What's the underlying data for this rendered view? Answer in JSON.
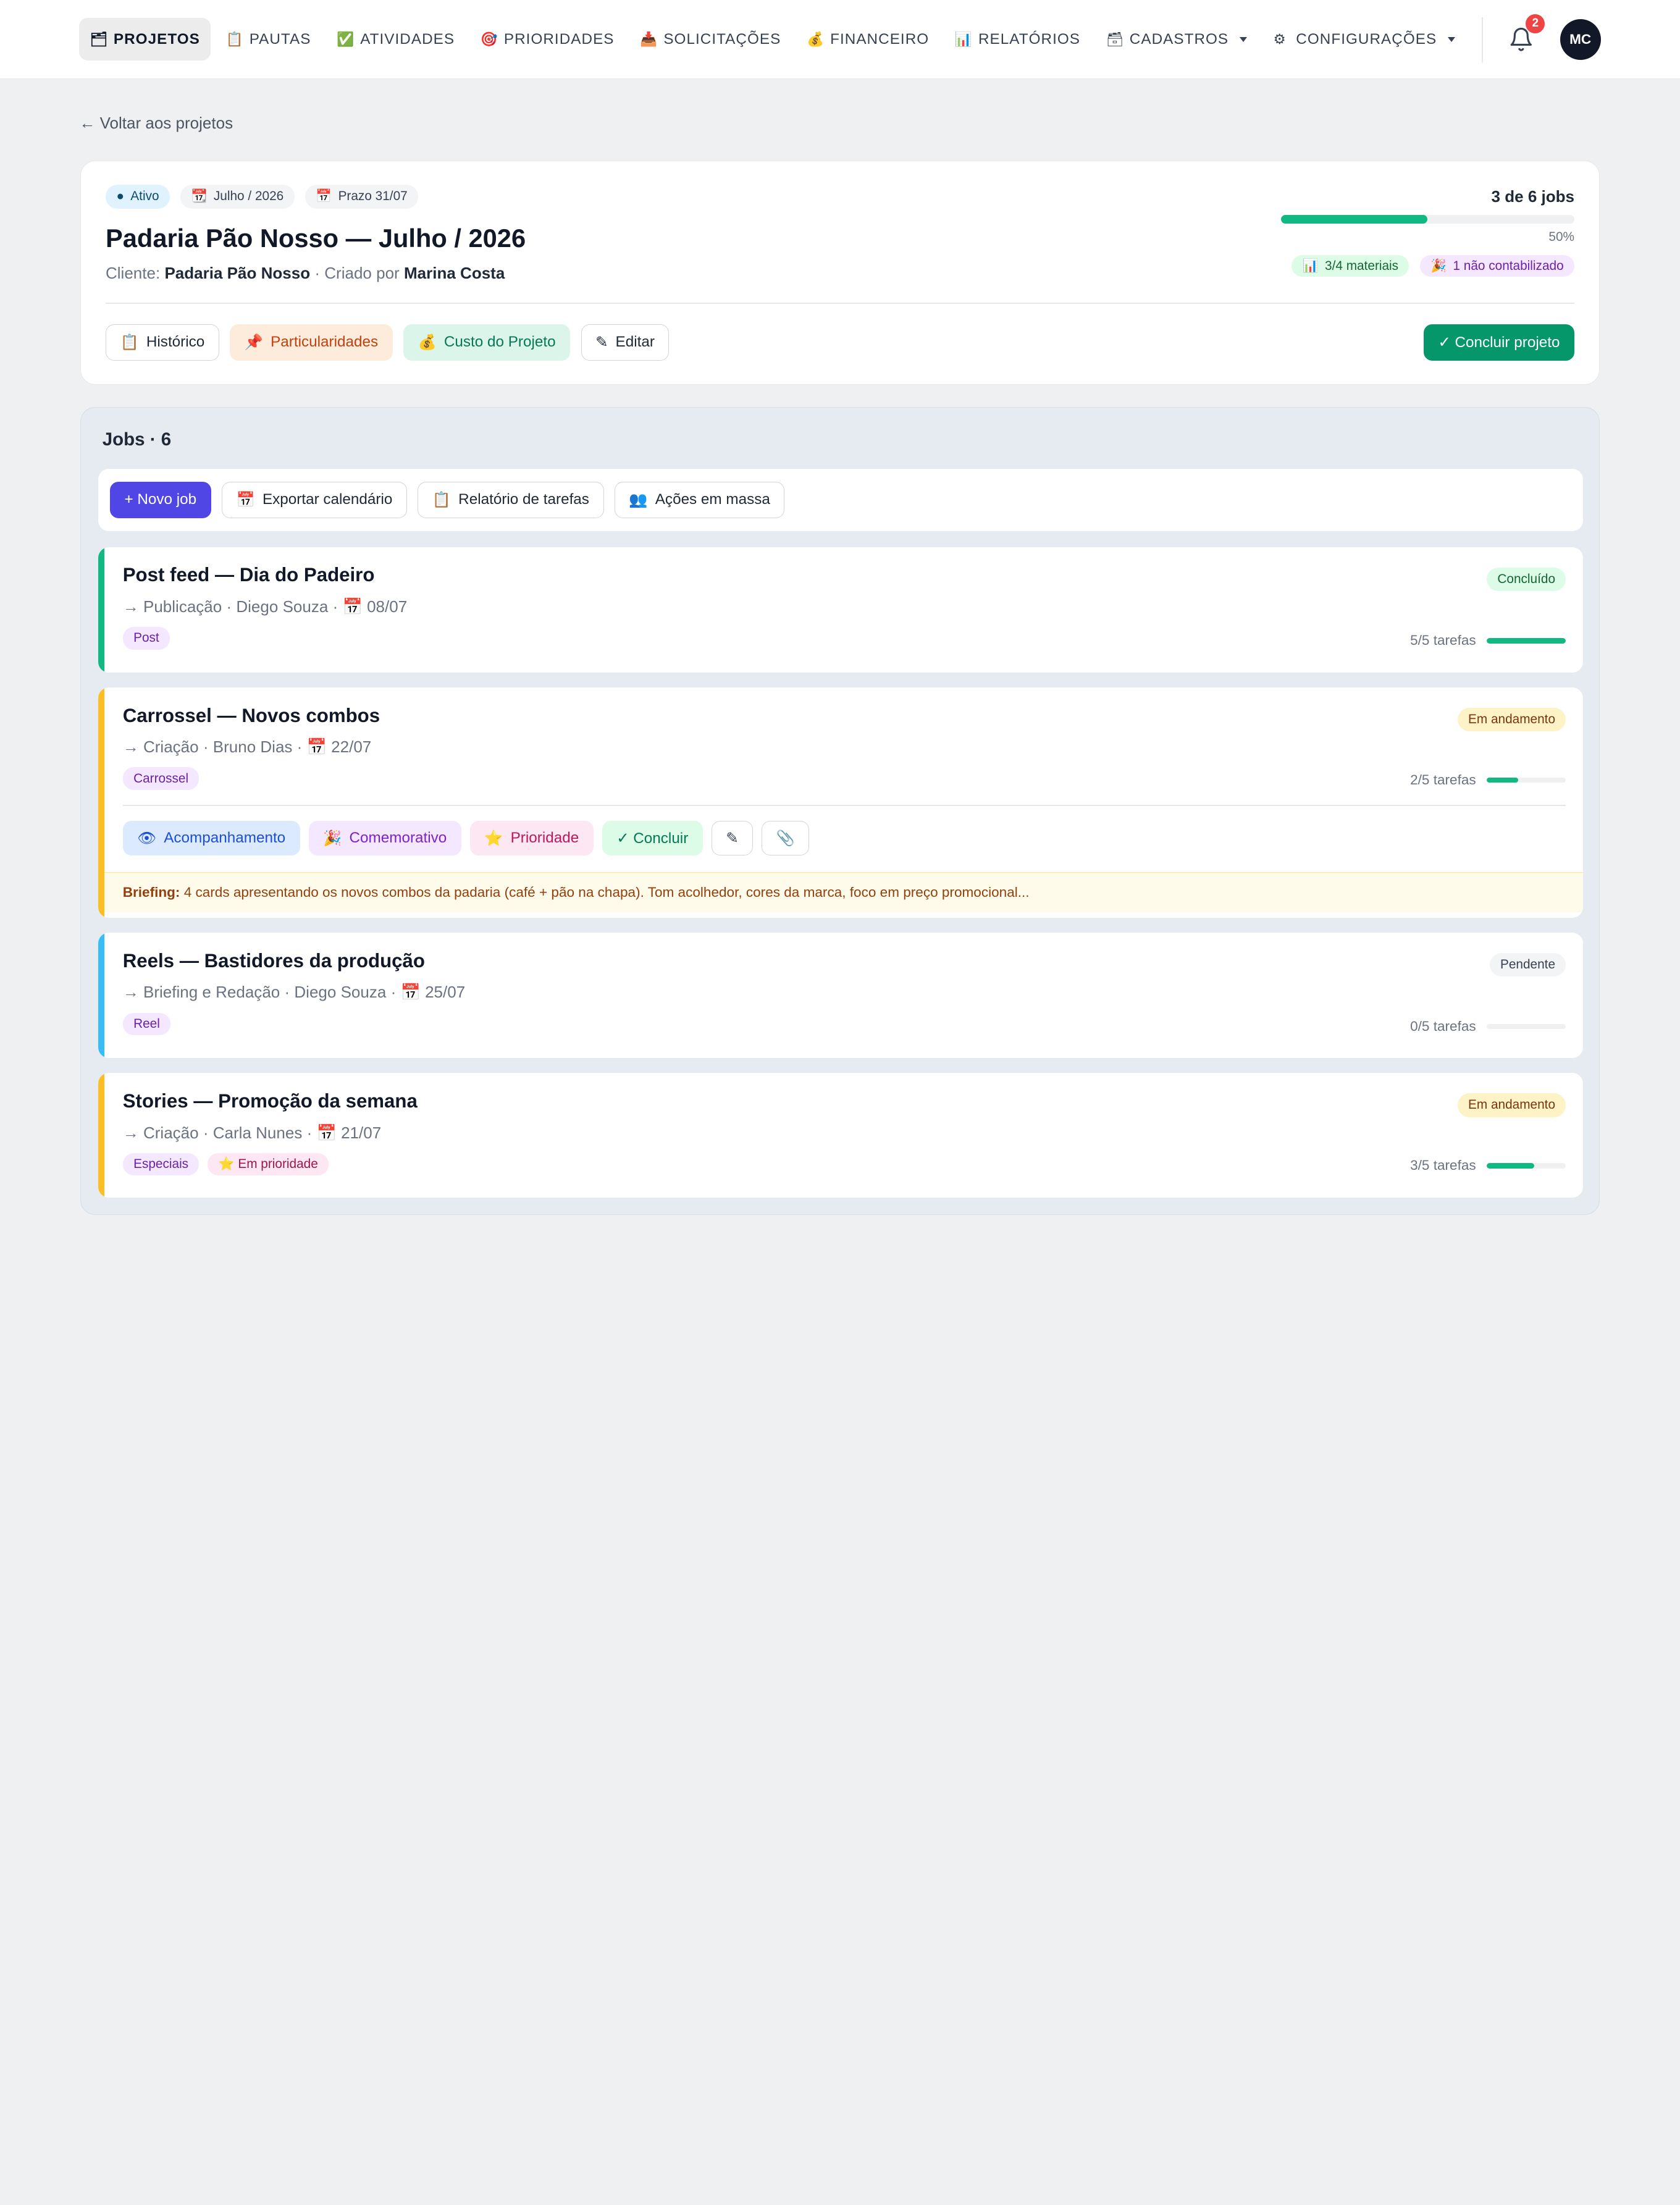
{
  "nav": {
    "items": [
      {
        "label": "PROJETOS",
        "icon": "🗂",
        "active": true
      },
      {
        "label": "PAUTAS",
        "icon": "📋"
      },
      {
        "label": "ATIVIDADES",
        "icon": "✅"
      },
      {
        "label": "PRIORIDADES",
        "icon": "🎯"
      },
      {
        "label": "SOLICITAÇÕES",
        "icon": "📥"
      },
      {
        "label": "FINANCEIRO",
        "icon": "💰"
      },
      {
        "label": "RELATÓRIOS",
        "icon": "📊"
      },
      {
        "label": "CADASTROS",
        "icon": "🗃"
      },
      {
        "label": "CONFIGURAÇÕES",
        "icon": "⚙"
      }
    ],
    "notifications": "2",
    "avatar": "MC"
  },
  "back_link": "← Voltar aos projetos",
  "project": {
    "status": "Ativo",
    "month": "Julho / 2026",
    "deadline": "Prazo 31/07",
    "title": "Padaria Pão Nosso — Julho / 2026",
    "client_label": "Cliente:",
    "client": "Padaria Pão Nosso",
    "created_label": "· Criado por",
    "created_by": "Marina Costa",
    "jobs_done": "3 de 6 jobs",
    "progress": 0.5,
    "progress_label": "50%",
    "materials": "3/4 materiais",
    "uncounted": "1 não contabilizado",
    "actions": {
      "history": "Histórico",
      "particularities": "Particularidades",
      "cost": "Custo do Projeto",
      "edit": "Editar",
      "complete": "✓ Concluir projeto"
    }
  },
  "jobs": {
    "title": "Jobs · 6",
    "toolbar": {
      "new_job": "+ Novo job",
      "export": "Exportar calendário",
      "report": "Relatório de tarefas",
      "bulk": "Ações em massa"
    },
    "items": [
      {
        "title": "Post feed — Dia do Padeiro",
        "meta": "→ Publicação · Diego Souza · 📅 08/07",
        "tags": [
          "Post"
        ],
        "status": "Concluído",
        "tasks": "5/5 tarefas",
        "progress": 1.0,
        "accent": "#10b981"
      },
      {
        "title": "Carrossel — Novos combos",
        "meta": "→ Criação · Bruno Dias · 📅 22/07",
        "tags": [
          "Carrossel"
        ],
        "status": "Em andamento",
        "tasks": "2/5 tarefas",
        "progress": 0.4,
        "accent": "#fbbf24",
        "actions": {
          "follow": "Acompanhamento",
          "commemorative": "Comemorativo",
          "priority": "Prioridade",
          "complete": "✓ Concluir"
        },
        "briefing_label": "Briefing:",
        "briefing": "4 cards apresentando os novos combos da padaria (café + pão na chapa). Tom acolhedor, cores da marca, foco em preço promocional..."
      },
      {
        "title": "Reels — Bastidores da produção",
        "meta": "→ Briefing e Redação · Diego Souza · 📅 25/07",
        "tags": [
          "Reel"
        ],
        "status": "Pendente",
        "tasks": "0/5 tarefas",
        "progress": 0.0,
        "accent": "#38bdf8"
      },
      {
        "title": "Stories — Promoção da semana",
        "meta": "→ Criação · Carla Nunes · 📅 21/07",
        "tags": [
          "Especiais",
          "⭐ Em prioridade"
        ],
        "status": "Em andamento",
        "tasks": "3/5 tarefas",
        "progress": 0.6,
        "accent": "#fbbf24"
      }
    ]
  }
}
